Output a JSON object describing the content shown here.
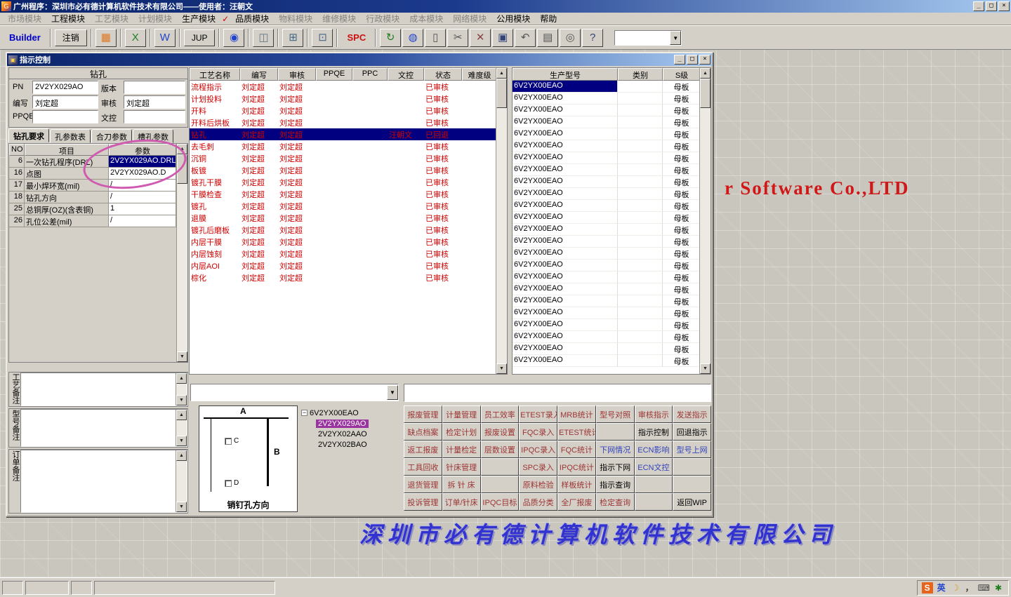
{
  "window": {
    "title": "广州程序：深圳市必有德计算机软件技术有限公司——使用者：汪朝文",
    "icon": "G",
    "minimize": "_",
    "maximize": "□",
    "close": "×"
  },
  "menu": {
    "items": [
      {
        "label": "市场模块",
        "enabled": false
      },
      {
        "label": "工程模块",
        "enabled": true
      },
      {
        "label": "工艺模块",
        "enabled": false
      },
      {
        "label": "计划模块",
        "enabled": false
      },
      {
        "label": "生产模块",
        "enabled": true
      },
      {
        "label": "✓",
        "enabled": true,
        "check": true
      },
      {
        "label": "品质模块",
        "enabled": true
      },
      {
        "label": "物料模块",
        "enabled": false
      },
      {
        "label": "维修模块",
        "enabled": false
      },
      {
        "label": "行政模块",
        "enabled": false
      },
      {
        "label": "成本模块",
        "enabled": false
      },
      {
        "label": "网络模块",
        "enabled": false
      },
      {
        "label": "公用模块",
        "enabled": true
      },
      {
        "label": "帮助",
        "enabled": true
      }
    ]
  },
  "toolbar": {
    "items": [
      {
        "type": "label",
        "name": "builder-label",
        "text": "Builder",
        "color": "#0000cc"
      },
      {
        "type": "sep"
      },
      {
        "type": "button",
        "name": "logout-button",
        "text": "注销"
      },
      {
        "type": "sep"
      },
      {
        "type": "icon",
        "name": "report-icon",
        "glyph": "▦",
        "color": "#e07820"
      },
      {
        "type": "sep"
      },
      {
        "type": "icon",
        "name": "excel-icon",
        "glyph": "X",
        "color": "#1e7d1e"
      },
      {
        "type": "sep"
      },
      {
        "type": "icon",
        "name": "word-icon",
        "glyph": "W",
        "color": "#2244cc"
      },
      {
        "type": "sep"
      },
      {
        "type": "button",
        "name": "jup-button",
        "text": "JUP"
      },
      {
        "type": "sep"
      },
      {
        "type": "icon",
        "name": "eye-icon",
        "glyph": "◉",
        "color": "#2244cc"
      },
      {
        "type": "sep"
      },
      {
        "type": "icon",
        "name": "database-icon",
        "glyph": "◫",
        "color": "#667788"
      },
      {
        "type": "sep"
      },
      {
        "type": "icon",
        "name": "workstations-icon",
        "glyph": "⊞",
        "color": "#446688"
      },
      {
        "type": "sep"
      },
      {
        "type": "icon",
        "name": "computer-icon",
        "glyph": "⊡",
        "color": "#446688"
      },
      {
        "type": "sep"
      },
      {
        "type": "label",
        "name": "spc-label",
        "text": "SPC",
        "color": "#cc1111"
      },
      {
        "type": "sep"
      },
      {
        "type": "icon",
        "name": "sync-icon",
        "glyph": "↻",
        "color": "#1e7d1e"
      },
      {
        "type": "icon",
        "name": "globe-icon",
        "glyph": "◍",
        "color": "#2244cc"
      },
      {
        "type": "icon",
        "name": "new-doc-icon",
        "glyph": "▯",
        "color": "#555555"
      },
      {
        "type": "icon",
        "name": "cut-icon",
        "glyph": "✂",
        "color": "#555555"
      },
      {
        "type": "icon",
        "name": "delete-icon",
        "glyph": "✕",
        "color": "#884444"
      },
      {
        "type": "icon",
        "name": "save-icon",
        "glyph": "▣",
        "color": "#334477"
      },
      {
        "type": "icon",
        "name": "undo-icon",
        "glyph": "↶",
        "color": "#555555"
      },
      {
        "type": "icon",
        "name": "print-icon",
        "glyph": "▤",
        "color": "#555555"
      },
      {
        "type": "icon",
        "name": "find-icon",
        "glyph": "◎",
        "color": "#555555"
      },
      {
        "type": "icon",
        "name": "help-icon",
        "glyph": "?",
        "color": "#334477"
      },
      {
        "type": "combo",
        "name": "toolbar-combo",
        "value": ""
      }
    ]
  },
  "child": {
    "title": "指示控制",
    "icon": "▣",
    "minimize": "_",
    "restore": "□",
    "close": "×"
  },
  "drill_panel": {
    "title": "钻孔",
    "fields": [
      {
        "label": "PN",
        "value": "2V2YX029AO"
      },
      {
        "label": "版本",
        "value": ""
      },
      {
        "label": "编写",
        "value": "刘定超"
      },
      {
        "label": "审核",
        "value": "刘定超"
      },
      {
        "label": "PPQE",
        "value": ""
      },
      {
        "label": "文控",
        "value": ""
      }
    ],
    "tabs": [
      "钻孔要求",
      "孔参数表",
      "合刀参数",
      "槽孔参数"
    ],
    "active_tab": "钻孔要求",
    "param_table": {
      "headers": [
        "NO",
        "项目",
        "参数"
      ],
      "rows": [
        {
          "no": "6",
          "item": "一次钻孔程序(DRL)",
          "param": "2V2YX029AO.DRL",
          "selected": true
        },
        {
          "no": "16",
          "item": "点图",
          "param": "2V2YX029AO.D"
        },
        {
          "no": "17",
          "item": "最小焊环宽(mil)",
          "param": "/"
        },
        {
          "no": "18",
          "item": "钻孔方向",
          "param": "/"
        },
        {
          "no": "25",
          "item": "总铜厚(OZ)(含表铜)",
          "param": "1"
        },
        {
          "no": "26",
          "item": "孔位公差(mil)",
          "param": "/"
        }
      ]
    }
  },
  "notes": [
    {
      "label": "工艺备注"
    },
    {
      "label": "型号备注"
    },
    {
      "label": "订单备注"
    }
  ],
  "process_table": {
    "headers": [
      "工艺名称",
      "编写",
      "审核",
      "PPQE",
      "PPC",
      "文控",
      "状态",
      "难度级"
    ],
    "rows": [
      {
        "name": "流程指示",
        "write": "刘定超",
        "audit": "刘定超",
        "status": "已审核"
      },
      {
        "name": "计划投料",
        "write": "刘定超",
        "audit": "刘定超",
        "status": "已审核"
      },
      {
        "name": "开料",
        "write": "刘定超",
        "audit": "刘定超",
        "status": "已审核"
      },
      {
        "name": "开料后烘板",
        "write": "刘定超",
        "audit": "刘定超",
        "status": "已审核"
      },
      {
        "name": "钻孔",
        "write": "刘定超",
        "audit": "刘定超",
        "doc": "汪朝文",
        "status": "已回退",
        "selected": true
      },
      {
        "name": "去毛刺",
        "write": "刘定超",
        "audit": "刘定超",
        "status": "已审核"
      },
      {
        "name": "沉铜",
        "write": "刘定超",
        "audit": "刘定超",
        "status": "已审核"
      },
      {
        "name": "板镀",
        "write": "刘定超",
        "audit": "刘定超",
        "status": "已审核"
      },
      {
        "name": "镀孔干膜",
        "write": "刘定超",
        "audit": "刘定超",
        "status": "已审核"
      },
      {
        "name": "干膜检查",
        "write": "刘定超",
        "audit": "刘定超",
        "status": "已审核"
      },
      {
        "name": "镀孔",
        "write": "刘定超",
        "audit": "刘定超",
        "status": "已审核"
      },
      {
        "name": "退膜",
        "write": "刘定超",
        "audit": "刘定超",
        "status": "已审核"
      },
      {
        "name": "镀孔后磨板",
        "write": "刘定超",
        "audit": "刘定超",
        "status": "已审核"
      },
      {
        "name": "内层干膜",
        "write": "刘定超",
        "audit": "刘定超",
        "status": "已审核"
      },
      {
        "name": "内层蚀刻",
        "write": "刘定超",
        "audit": "刘定超",
        "status": "已审核"
      },
      {
        "name": "内层AOI",
        "write": "刘定超",
        "audit": "刘定超",
        "status": "已审核"
      },
      {
        "name": "棕化",
        "write": "刘定超",
        "audit": "刘定超",
        "status": "已审核"
      }
    ]
  },
  "model_table": {
    "headers": [
      "生产型号",
      "类别",
      "S级"
    ],
    "row_model": "6V2YX00EAO",
    "row_category": "",
    "row_s_level": "母板",
    "row_count": 24,
    "selected_index": 0
  },
  "tree": {
    "root": "6V2YX00EAO",
    "children": [
      {
        "label": "2V2YX029AO",
        "selected": true
      },
      {
        "label": "2V2YX02AAO"
      },
      {
        "label": "2V2YX02BAO"
      }
    ]
  },
  "diagram": {
    "label_a": "A",
    "label_b": "B",
    "checkbox_c": "C",
    "checkbox_d": "D",
    "caption": "销钉孔方向"
  },
  "button_grid": {
    "colors": {
      "m": "#9c3434",
      "b": "#3344bb",
      "k": "#000000"
    },
    "rows": [
      [
        [
          "报废管理",
          "m"
        ],
        [
          "计量管理",
          "m"
        ],
        [
          "员工效率",
          "m"
        ],
        [
          "ETEST录入",
          "m"
        ],
        [
          "MRB统计",
          "m"
        ],
        [
          "型号对照",
          "m"
        ],
        [
          "审核指示",
          "m"
        ],
        [
          "发送指示",
          "m"
        ]
      ],
      [
        [
          "缺点档案",
          "m"
        ],
        [
          "检定计划",
          "m"
        ],
        [
          "报废设置",
          "m"
        ],
        [
          "FQC录入",
          "m"
        ],
        [
          "ETEST统计",
          "m"
        ],
        [
          "",
          ""
        ],
        [
          "指示控制",
          "k"
        ],
        [
          "回退指示",
          "k"
        ]
      ],
      [
        [
          "返工报废",
          "m"
        ],
        [
          "计量检定",
          "m"
        ],
        [
          "层数设置",
          "m"
        ],
        [
          "IPQC录入",
          "m"
        ],
        [
          "FQC统计",
          "m"
        ],
        [
          "下网情况",
          "b"
        ],
        [
          "ECN影响",
          "b"
        ],
        [
          "型号上网",
          "b"
        ]
      ],
      [
        [
          "工具回收",
          "m"
        ],
        [
          "针床管理",
          "m"
        ],
        [
          "",
          ""
        ],
        [
          "SPC录入",
          "m"
        ],
        [
          "IPQC统计",
          "m"
        ],
        [
          "指示下网",
          "k"
        ],
        [
          "ECN文控",
          "b"
        ],
        [
          "",
          ""
        ]
      ],
      [
        [
          "退货管理",
          "m"
        ],
        [
          "拆 针 床",
          "m"
        ],
        [
          "",
          ""
        ],
        [
          "原料检验",
          "m"
        ],
        [
          "样板统计",
          "m"
        ],
        [
          "指示查询",
          "k"
        ],
        [
          "",
          ""
        ],
        [
          "",
          ""
        ]
      ],
      [
        [
          "投诉管理",
          "m"
        ],
        [
          "订单/针床",
          "m"
        ],
        [
          "IPQC目标",
          "m"
        ],
        [
          "品质分类",
          "m"
        ],
        [
          "全厂报废",
          "m"
        ],
        [
          "检定查询",
          "m"
        ],
        [
          "",
          ""
        ],
        [
          "返回WIP",
          "k"
        ]
      ]
    ]
  },
  "watermarks": {
    "english": "r Software Co.,LTD",
    "chinese": "深圳市必有德计算机软件技术有限公司"
  },
  "tray": {
    "icons": [
      {
        "name": "sogou-icon",
        "glyph": "S",
        "fg": "#ffffff",
        "bg": "#e8641c"
      },
      {
        "name": "lang-indicator",
        "glyph": "英",
        "fg": "#2244cc",
        "bg": ""
      },
      {
        "name": "moon-icon",
        "glyph": "☽",
        "fg": "#d4a017",
        "bg": ""
      },
      {
        "name": "punctuation-icon",
        "glyph": "，",
        "fg": "#444444",
        "bg": ""
      },
      {
        "name": "keyboard-icon",
        "glyph": "⌨",
        "fg": "#444444",
        "bg": ""
      },
      {
        "name": "toolbox-icon",
        "glyph": "✱",
        "fg": "#1e7d1e",
        "bg": ""
      }
    ]
  }
}
